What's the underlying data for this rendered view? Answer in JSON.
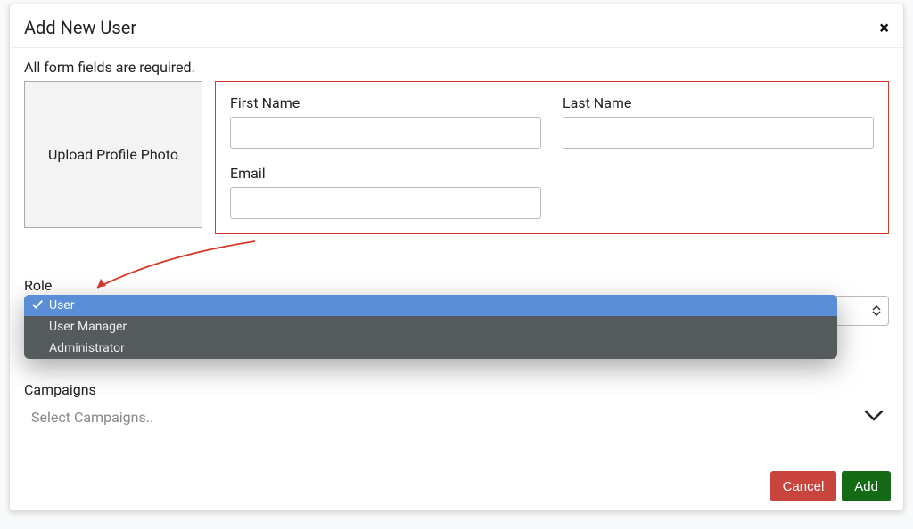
{
  "modal": {
    "title": "Add New User",
    "close_glyph": "×",
    "required_text": "All form fields are required.",
    "upload_label": "Upload Profile Photo"
  },
  "fields": {
    "first_name": {
      "label": "First Name",
      "value": ""
    },
    "last_name": {
      "label": "Last Name",
      "value": ""
    },
    "email": {
      "label": "Email",
      "value": ""
    }
  },
  "role": {
    "label": "Role",
    "selected": "User",
    "options": [
      "User",
      "User Manager",
      "Administrator"
    ]
  },
  "campaigns": {
    "label": "Campaigns",
    "placeholder": "Select Campaigns.."
  },
  "footer": {
    "cancel": "Cancel",
    "add": "Add"
  },
  "colors": {
    "annotation": "#d63a2a",
    "dropdown_bg": "#555a5d",
    "dropdown_selected": "#5a8fd8",
    "cancel": "#c8443d",
    "add": "#156a16"
  }
}
